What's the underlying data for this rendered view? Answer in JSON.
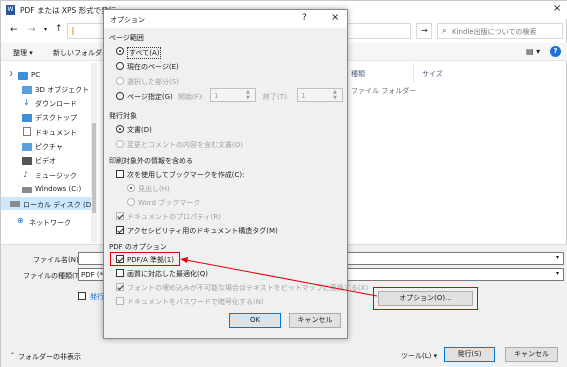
{
  "bg_window": {
    "title": "PDF または XPS 形式で発行",
    "close_glyph": "×",
    "nav": {
      "back": "←",
      "forward": "→",
      "up": "↑"
    },
    "address_value": "‖",
    "address_refresh": "→",
    "search_placeholder": "Kindle出版についての検索",
    "toolbar": {
      "organize": "整理 ▾",
      "new_folder": "新しいフォルダー",
      "help": "?"
    },
    "columns": {
      "type": "種類",
      "size": "サイズ"
    },
    "file_row_type": "ファイル フォルダー",
    "sidebar": [
      {
        "label": "PC",
        "icon": "pc-icon"
      },
      {
        "label": "3D オブジェクト",
        "icon": "3d-objects-icon"
      },
      {
        "label": "ダウンロード",
        "icon": "download-icon"
      },
      {
        "label": "デスクトップ",
        "icon": "desktop-icon"
      },
      {
        "label": "ドキュメント",
        "icon": "document-icon"
      },
      {
        "label": "ピクチャ",
        "icon": "picture-icon"
      },
      {
        "label": "ビデオ",
        "icon": "video-icon"
      },
      {
        "label": "ミュージック",
        "icon": "music-icon"
      },
      {
        "label": "Windows (C:)",
        "icon": "drive-icon"
      },
      {
        "label": "ローカル ディスク (D",
        "icon": "drive-icon"
      },
      {
        "label": "ネットワーク",
        "icon": "network-icon"
      }
    ],
    "filename_label": "ファイル名(N):",
    "filetype_label": "ファイルの種類(T):",
    "filetype_value": "PDF (*.p",
    "publish_checkbox_label": "発行",
    "options_button": "オプション(O)...",
    "hide_folders": "フォルダーの非表示",
    "tools_button": "ツール(L)",
    "publish_button": "発行(S)",
    "cancel_button": "キャンセル"
  },
  "dialog": {
    "title": "オプション",
    "help_glyph": "?",
    "close_glyph": "×",
    "page_range": {
      "title": "ページ範囲",
      "all": "すべて(A)",
      "current": "現在のページ(E)",
      "selection": "選択した部分(S)",
      "pages": "ページ指定(G)",
      "from_label": "開始(F):",
      "from_value": "1",
      "to_label": "終了(T):",
      "to_value": "1"
    },
    "publish_what": {
      "title": "発行対象",
      "document": "文書(D)",
      "markup": "変更とコメントの内容を含む文書(O)"
    },
    "non_print": {
      "title": "印刷対象外の情報を含める",
      "bookmarks": "次を使用してブックマークを作成(C):",
      "headings": "見出し(H)",
      "word_bookmarks": "Word ブックマーク",
      "properties": "ドキュメントのプロパティ(R)",
      "accessibility": "アクセシビリティ用のドキュメント構造タグ(M)"
    },
    "pdf_options": {
      "title": "PDF のオプション",
      "pdfa": "PDF/A 準拠(1)",
      "optimize": "画質に対応した最適化(Q)",
      "bitmap": "フォントの埋め込みが不可能な場合はテキストをビットマップに変換する(X)",
      "encrypt": "ドキュメントをパスワードで暗号化する(N)"
    },
    "ok": "OK",
    "cancel": "キャンセル"
  },
  "colors": {
    "accent": "#0078d7",
    "annotation_red": "#e0000e",
    "toolbar_bg": "#f5f6f7",
    "dialog_bg": "#f0f0f0"
  }
}
